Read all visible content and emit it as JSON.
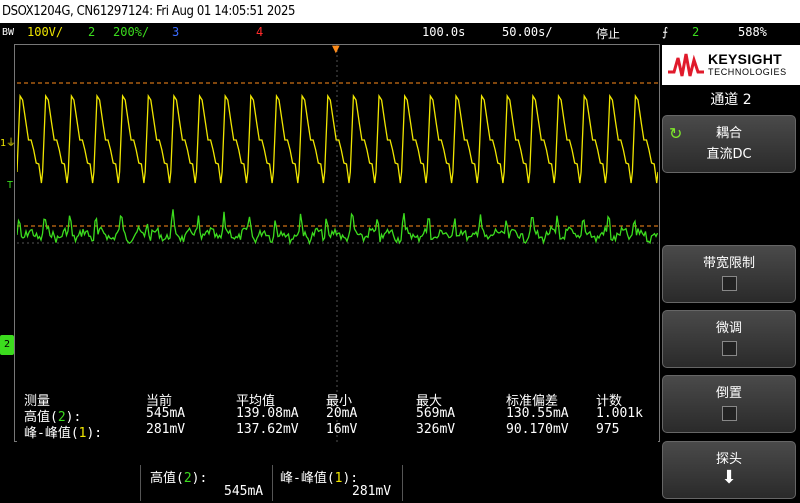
{
  "title_bar": {
    "text": "DSOX1204G, CN61297124: Fri Aug 01 14:05:51 2025"
  },
  "status": {
    "bw": "BW",
    "ch1_scale": "100V/",
    "ch2_num": "2",
    "ch2_scale": "200%/",
    "ch3_num": "3",
    "ch4_num": "4",
    "time_delay": "100.0s",
    "time_scale": "50.00s/",
    "run_state": "停止",
    "trigger_icon": "trigger-edge-icon",
    "trigger_ch": "2",
    "trigger_level": "588%"
  },
  "colors": {
    "ch1": "#f0e600",
    "ch2": "#3cdc1e",
    "ch3": "#3a6cff",
    "ch4": "#ff2a2a",
    "trigger": "#ff8c1a",
    "accent_green": "#7ee62a"
  },
  "markers": {
    "ch1": "1",
    "trigger": "T",
    "ch2": "2"
  },
  "measurements": {
    "headers": [
      "测量",
      "当前",
      "平均值",
      "最小",
      "最大",
      "标准偏差",
      "计数"
    ],
    "rows": [
      {
        "name_prefix": "高值(",
        "name_ch": "2",
        "name_suffix": "):",
        "current": "545mA",
        "mean": "139.08mA",
        "min": "20mA",
        "max": "569mA",
        "std": "130.55mA",
        "count": "1.001k"
      },
      {
        "name_prefix": "峰-峰值(",
        "name_ch": "1",
        "name_suffix": "):",
        "current": "281mV",
        "mean": "137.62mV",
        "min": "16mV",
        "max": "326mV",
        "std": "90.170mV",
        "count": "975"
      }
    ]
  },
  "bottom": {
    "m1_label_prefix": "高值(",
    "m1_label_ch": "2",
    "m1_label_suffix": "):",
    "m1_value": "545mA",
    "m2_label_prefix": "峰-峰值(",
    "m2_label_ch": "1",
    "m2_label_suffix": "):",
    "m2_value": "281mV"
  },
  "panel": {
    "brand": "KEYSIGHT",
    "brand_sub": "TECHNOLOGIES",
    "channel_title": "通道 2",
    "coupling_label": "耦合",
    "coupling_value": "直流DC",
    "bw_limit_label": "带宽限制",
    "fine_label": "微调",
    "invert_label": "倒置",
    "probe_label": "探头",
    "refresh_icon": "refresh-icon",
    "probe_icon": "down-arrow-icon"
  }
}
